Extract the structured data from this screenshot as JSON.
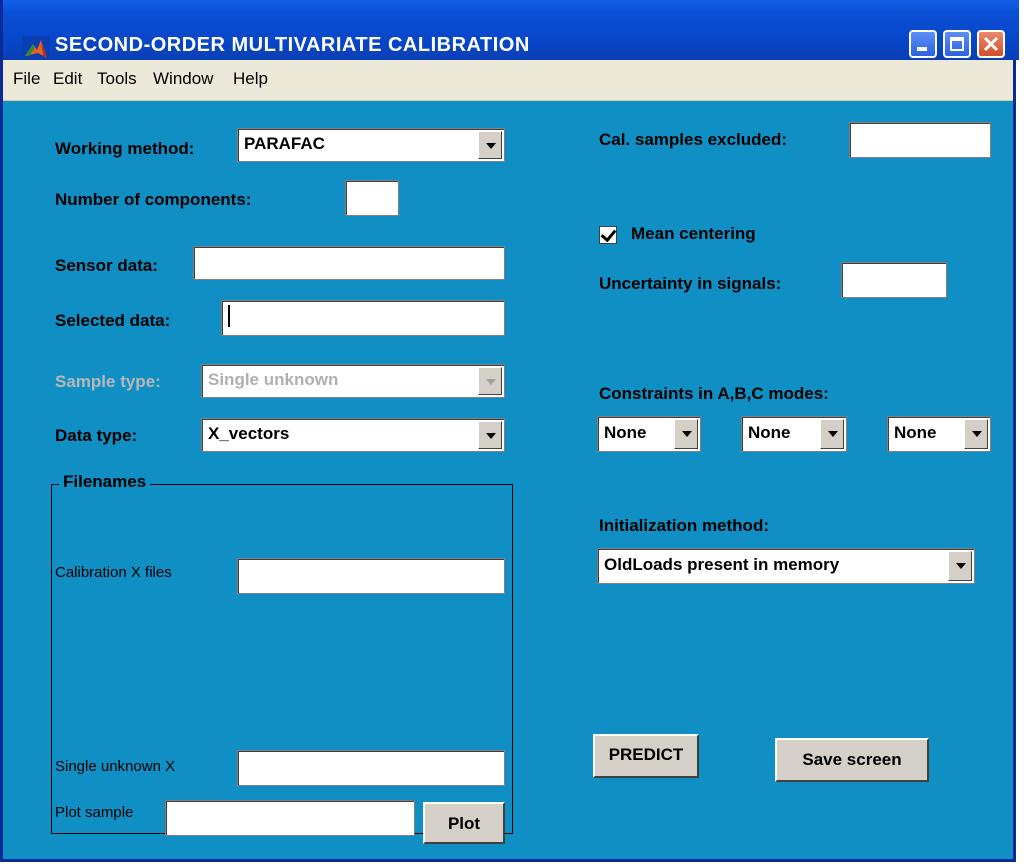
{
  "window": {
    "title": "SECOND-ORDER MULTIVARIATE CALIBRATION"
  },
  "menu": [
    "File",
    "Edit",
    "Tools",
    "Window",
    "Help"
  ],
  "left": {
    "working_method_label": "Working method:",
    "working_method_value": "PARAFAC",
    "num_components_label": "Number of components:",
    "num_components_value": "",
    "sensor_data_label": "Sensor data:",
    "sensor_data_value": "",
    "selected_data_label": "Selected data:",
    "selected_data_value": "",
    "sample_type_label": "Sample type:",
    "sample_type_value": "Single unknown",
    "data_type_label": "Data type:",
    "data_type_value": "X_vectors"
  },
  "filenames": {
    "title": "Filenames",
    "calibration_label": "Calibration X files",
    "calibration_value": "",
    "single_unknown_label": "Single unknown X",
    "single_unknown_value": ""
  },
  "plot": {
    "label": "Plot sample",
    "value": "",
    "button": "Plot"
  },
  "right": {
    "cal_excluded_label": "Cal. samples excluded:",
    "cal_excluded_value": "",
    "mean_centering_label": "Mean centering",
    "mean_centering_checked": true,
    "uncertainty_label": "Uncertainty in signals:",
    "uncertainty_value": "",
    "constraints_label": "Constraints in A,B,C modes:",
    "constraint_a": "None",
    "constraint_b": "None",
    "constraint_c": "None",
    "init_label": "Initialization method:",
    "init_value": "OldLoads present in memory",
    "predict_button": "PREDICT",
    "save_button": "Save screen"
  },
  "colors": {
    "client_bg": "#0f8fc3",
    "titlebar": "#0a4fd6",
    "menubar": "#ece9d8"
  }
}
